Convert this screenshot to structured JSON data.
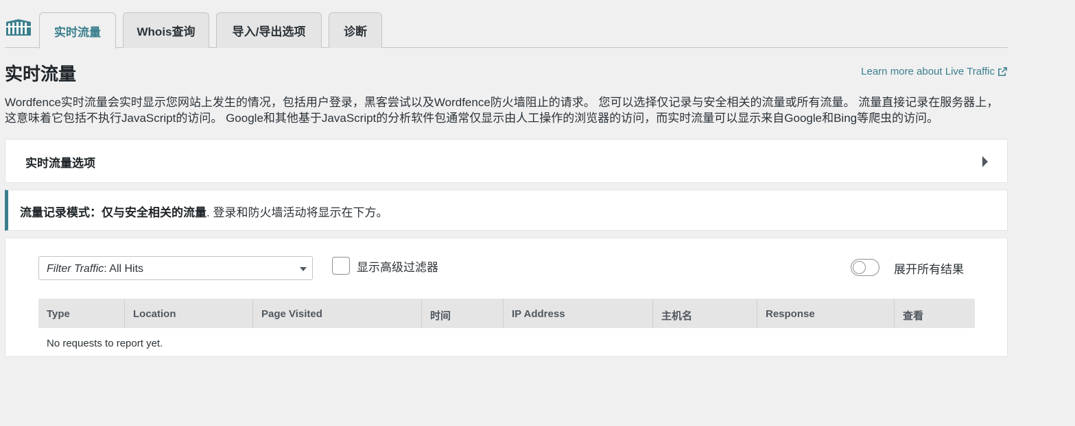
{
  "tabs": [
    {
      "label": "实时流量",
      "active": true
    },
    {
      "label": "Whois查询",
      "active": false
    },
    {
      "label": "导入/导出选项",
      "active": false
    },
    {
      "label": "诊断",
      "active": false
    }
  ],
  "page": {
    "title": "实时流量",
    "learn_more": "Learn more about Live Traffic",
    "description": "Wordfence实时流量会实时显示您网站上发生的情况，包括用户登录，黑客尝试以及Wordfence防火墙阻止的请求。 您可以选择仅记录与安全相关的流量或所有流量。 流量直接记录在服务器上，这意味着它包括不执行JavaScript的访问。 Google和其他基于JavaScript的分析软件包通常仅显示由人工操作的浏览器的访问，而实时流量可以显示来自Google和Bing等爬虫的访问。"
  },
  "options_panel": {
    "title": "实时流量选项"
  },
  "mode_notice": {
    "label": "流量记录模式：",
    "mode": "仅与安全相关的流量",
    "suffix": ". 登录和防火墙活动将显示在下方。"
  },
  "filters": {
    "select_prefix": "Filter Traffic",
    "select_value": ": All Hits",
    "advanced_label": "显示高级过滤器",
    "expand_label": "展开所有结果"
  },
  "table": {
    "columns": [
      "Type",
      "Location",
      "Page Visited",
      "时间",
      "IP Address",
      "主机名",
      "Response",
      "查看"
    ],
    "empty_message": "No requests to report yet."
  },
  "colors": {
    "accent": "#3b7f8c",
    "background": "#f0f0f1",
    "tab_inactive": "#e5e5e5"
  },
  "icons": {
    "logo": "wordfence-logo-icon",
    "external_link": "external-link-icon",
    "expand": "caret-right-icon",
    "select": "chevron-down-icon"
  }
}
